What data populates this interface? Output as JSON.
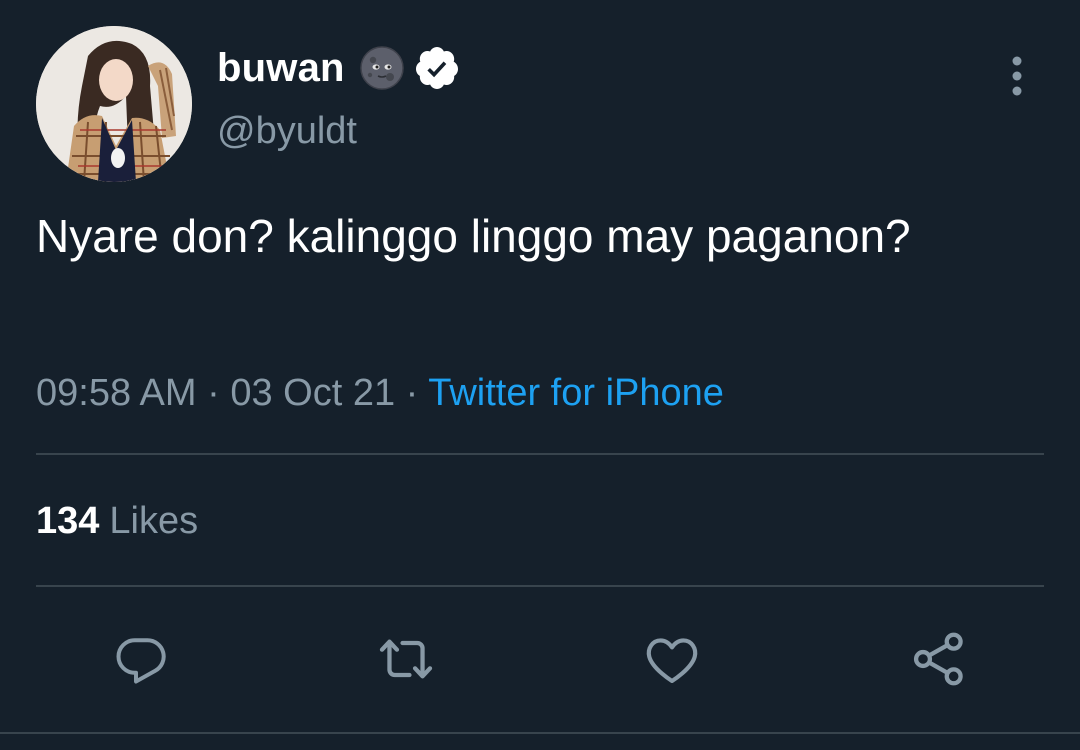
{
  "user": {
    "display_name": "buwan",
    "handle": "@byuldt",
    "emoji_icon": "new-moon-face-icon",
    "verified_icon": "verified-badge-icon"
  },
  "tweet": {
    "text": "Nyare don? kalinggo linggo may paganon?",
    "time": "09:58 AM",
    "date": "03 Oct 21",
    "separator": " · ",
    "source": "Twitter for iPhone"
  },
  "stats": {
    "likes_count": "134",
    "likes_label": "Likes"
  },
  "actions": {
    "icons": [
      "reply-icon",
      "retweet-icon",
      "like-icon",
      "share-icon"
    ]
  },
  "colors": {
    "background": "#15202b",
    "text_primary": "#ffffff",
    "text_secondary": "#8899a6",
    "accent": "#1da1f2",
    "divider": "#38444d"
  }
}
